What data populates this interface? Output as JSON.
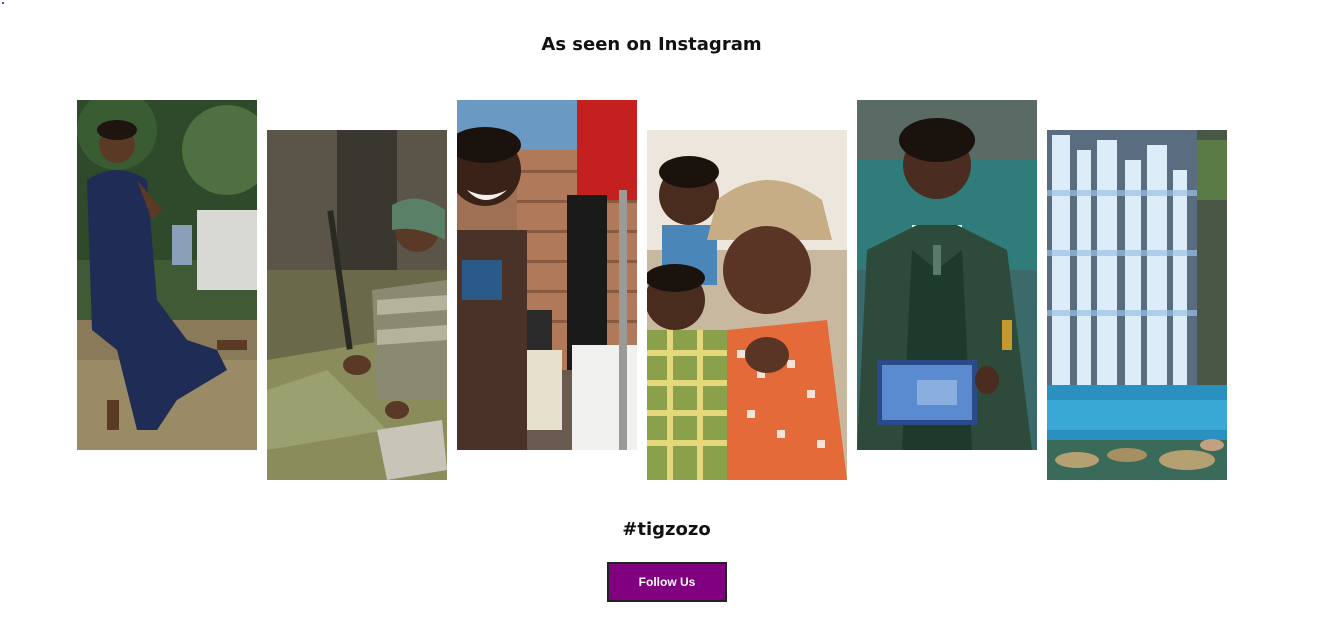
{
  "section": {
    "title": "As seen on Instagram",
    "hashtag": "#tigzozo"
  },
  "follow_button": {
    "label": "Follow Us",
    "color": "#800080"
  },
  "gallery": {
    "tiles": [
      {
        "icon": "woman-in-blue-dress-photo"
      },
      {
        "icon": "woman-harvesting-sugarcane-photo"
      },
      {
        "icon": "smiling-boy-at-water-tap-photo"
      },
      {
        "icon": "grandmother-with-children-photo"
      },
      {
        "icon": "student-with-tablet-photo"
      },
      {
        "icon": "waterfall-photo"
      }
    ]
  }
}
